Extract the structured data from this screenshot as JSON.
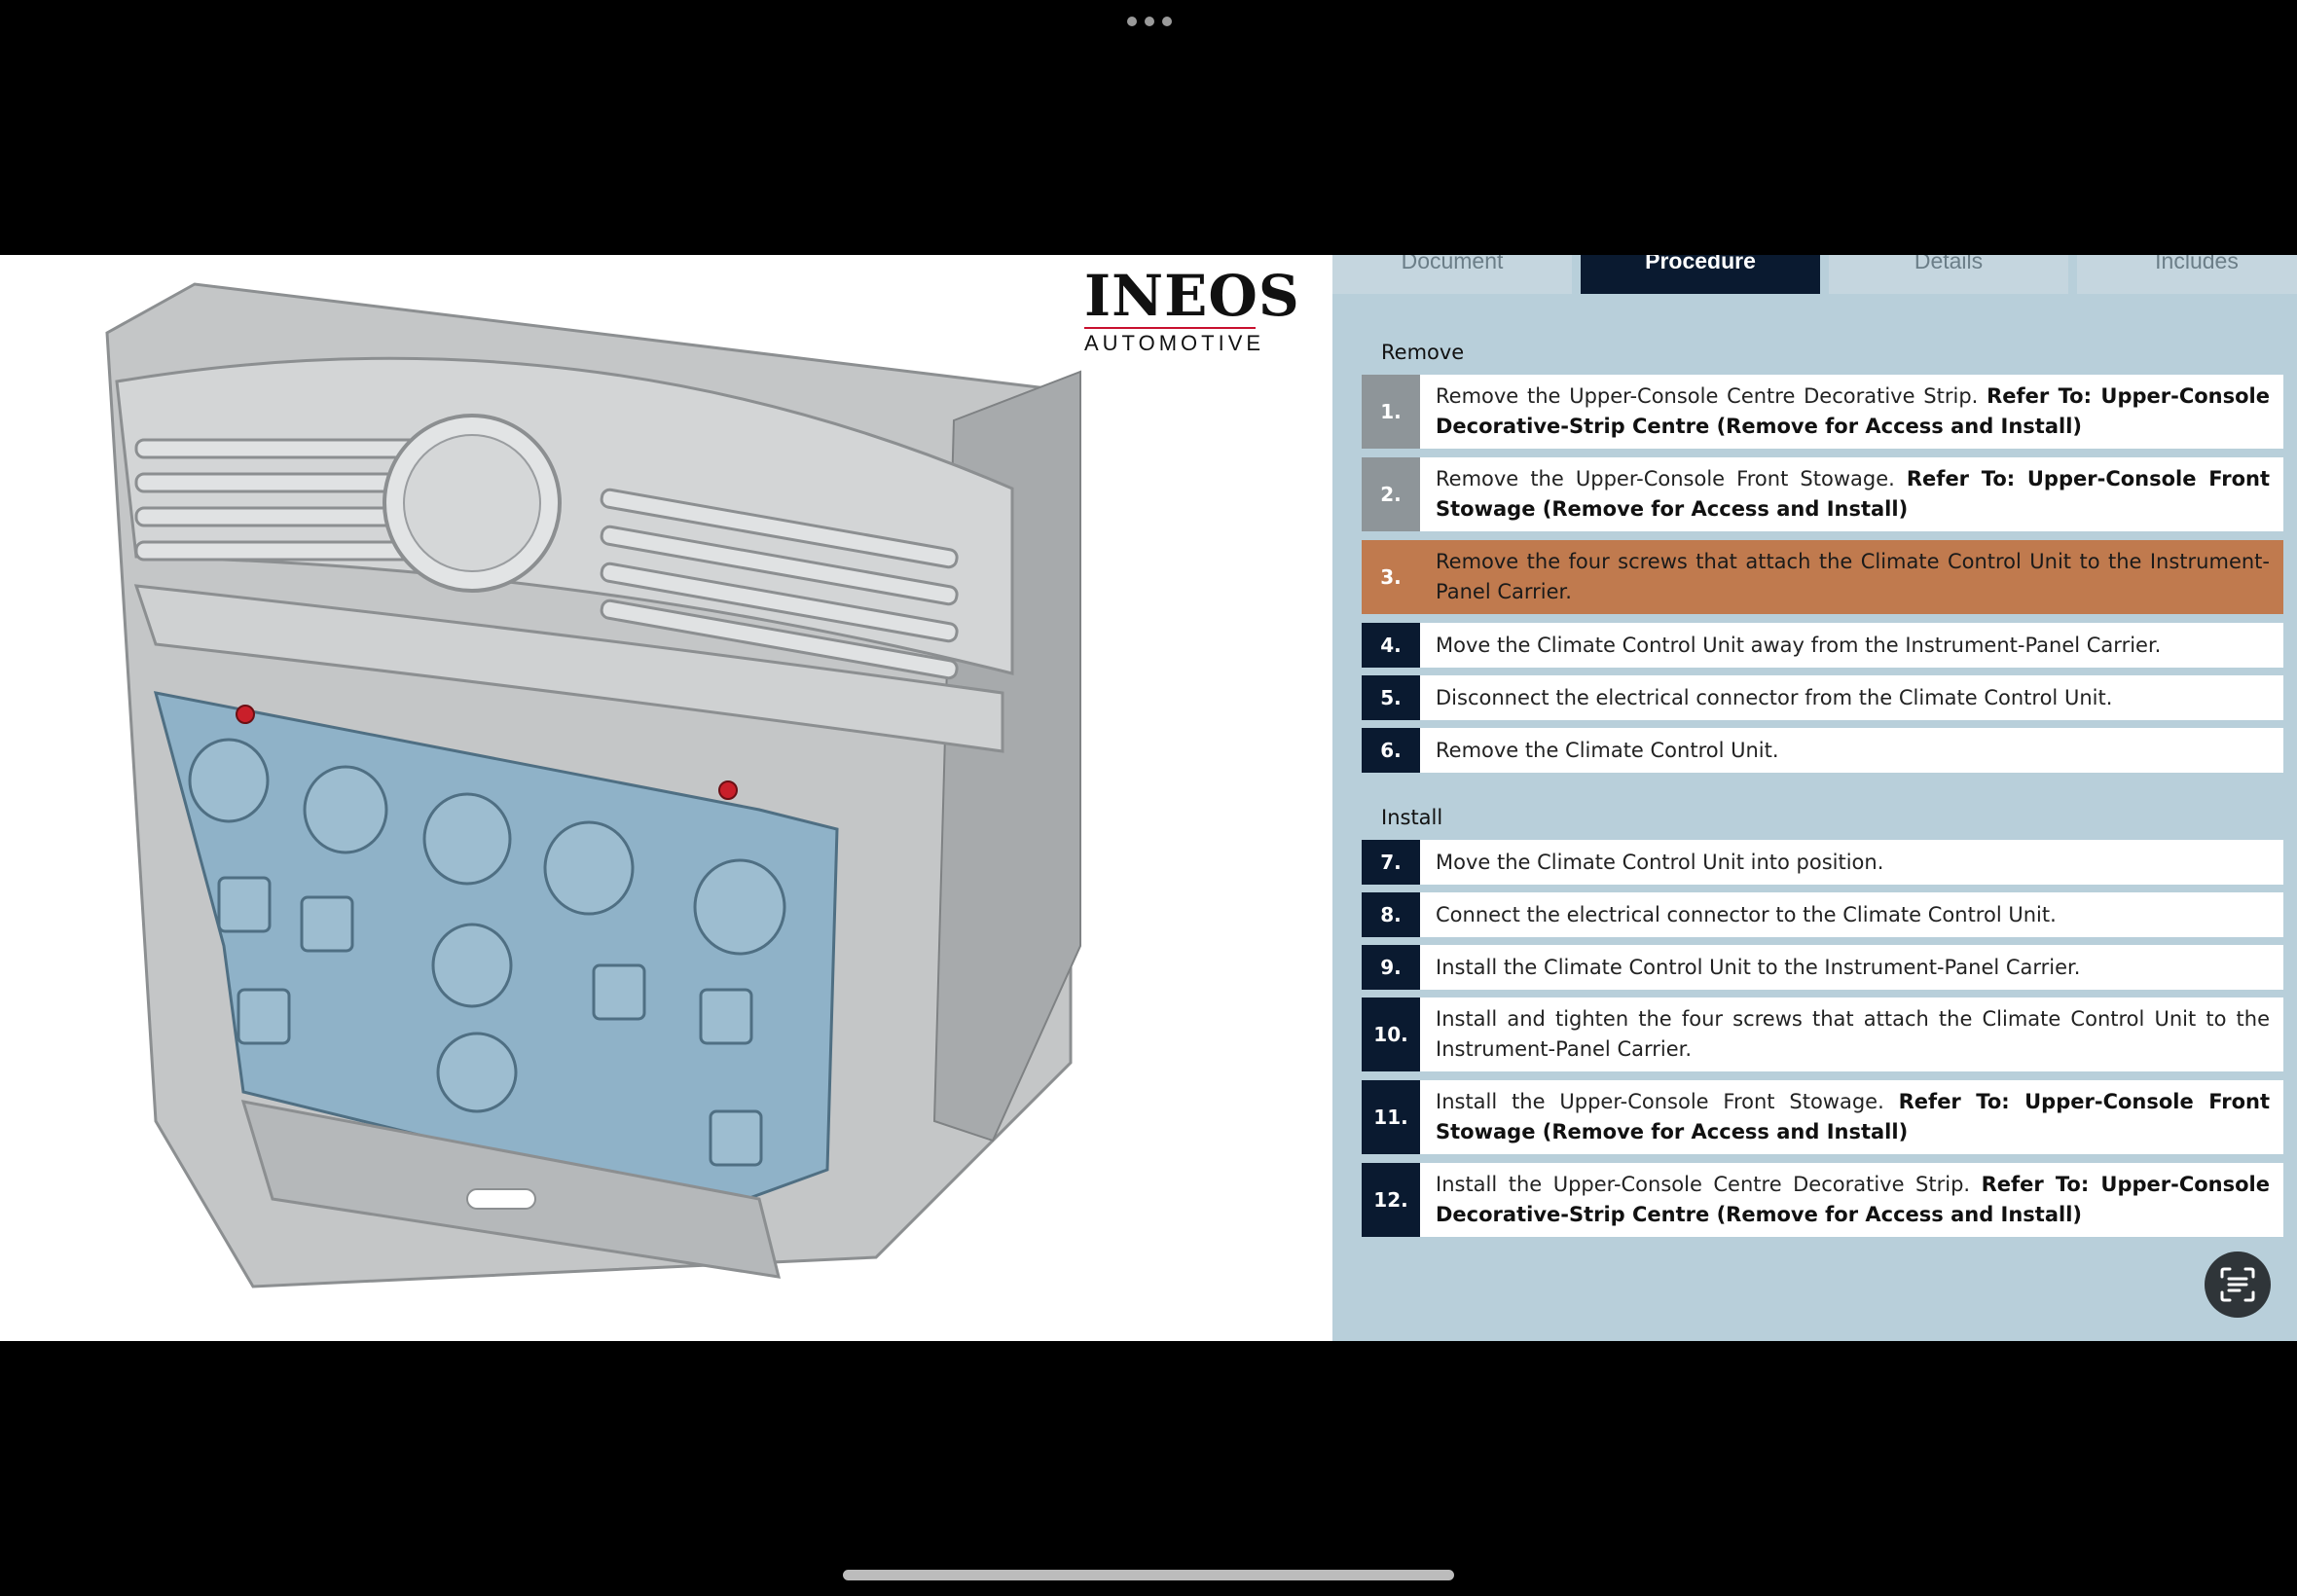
{
  "logo": {
    "main": "INEOS",
    "sub": "AUTOMOTIVE"
  },
  "tabs": [
    {
      "label": "Document",
      "active": false
    },
    {
      "label": "Procedure",
      "active": true
    },
    {
      "label": "Details",
      "active": false
    },
    {
      "label": "Includes",
      "active": false
    }
  ],
  "sections": {
    "remove_title": "Remove",
    "install_title": "Install"
  },
  "steps": [
    {
      "num": "1.",
      "text": "Remove the Upper-Console Centre Decorative Strip. ",
      "ref": "Refer To: Upper-Console Decorative-Strip Centre (Remove for Access and Install)",
      "state": "done"
    },
    {
      "num": "2.",
      "text": "Remove the Upper-Console Front Stowage. ",
      "ref": "Refer To: Upper-Console Front Stowage (Remove for Access and Install)",
      "state": "done"
    },
    {
      "num": "3.",
      "text": "Remove the four screws that attach the Climate Control Unit to the Instrument-Panel Carrier.",
      "ref": "",
      "state": "active"
    },
    {
      "num": "4.",
      "text": "Move the Climate Control Unit away from the Instrument-Panel Carrier.",
      "ref": "",
      "state": "pending"
    },
    {
      "num": "5.",
      "text": "Disconnect the electrical connector from the Climate Control Unit.",
      "ref": "",
      "state": "pending"
    },
    {
      "num": "6.",
      "text": "Remove the Climate Control Unit.",
      "ref": "",
      "state": "pending"
    },
    {
      "num": "7.",
      "text": "Move the Climate Control Unit into position.",
      "ref": "",
      "state": "pending"
    },
    {
      "num": "8.",
      "text": "Connect the electrical connector to the Climate Control Unit.",
      "ref": "",
      "state": "pending"
    },
    {
      "num": "9.",
      "text": "Install the Climate Control Unit to the Instrument-Panel Carrier.",
      "ref": "",
      "state": "pending"
    },
    {
      "num": "10.",
      "text": "Install and tighten the four screws that attach the Climate Control Unit to the Instrument-Panel Carrier.",
      "ref": "",
      "state": "pending"
    },
    {
      "num": "11.",
      "text": "Install the Upper-Console Front Stowage. ",
      "ref": "Refer To: Upper-Console Front Stowage (Remove for Access and Install)",
      "state": "pending"
    },
    {
      "num": "12.",
      "text": "Install the Upper-Console Centre Decorative Strip. ",
      "ref": "Refer To: Upper-Console Decorative-Strip Centre (Remove for Access and Install)",
      "state": "pending"
    }
  ],
  "colors": {
    "panel_bg": "#b8cfda",
    "navy": "#0a1a30",
    "active_step": "#c07a4e",
    "done_step": "#8e9599",
    "part_highlight": "#8fb2c8"
  },
  "icons": {
    "fab": "text-scan-icon",
    "top": "more-dots-icon"
  }
}
